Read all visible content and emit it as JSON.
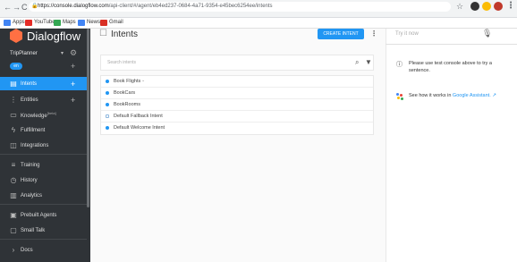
{
  "browser": {
    "back": "←",
    "forward": "→",
    "reload": "C",
    "url_domain": "https://console.dialogflow.com",
    "url_path": "/api-client/#/agent/eb4ed237-0684-4a71-9354-e45bec6254ee/intents",
    "bookmarks": [
      {
        "label": "Apps",
        "color": "#4285f4"
      },
      {
        "label": "YouTube",
        "color": "#e52d27"
      },
      {
        "label": "Maps",
        "color": "#34a853"
      },
      {
        "label": "News",
        "color": "#4285f4"
      },
      {
        "label": "Gmail",
        "color": "#d93025"
      }
    ]
  },
  "sidebar": {
    "brand": "Dialogflow",
    "agent_name": "TripPlanner",
    "language": "en",
    "items": [
      {
        "label": "Intents",
        "icon": "chat-icon",
        "active": true,
        "plus": true
      },
      {
        "label": "Entities",
        "icon": "entities-icon",
        "active": false,
        "plus": true
      },
      {
        "label": "Knowledge",
        "beta": "[beta]",
        "icon": "knowledge-icon",
        "active": false,
        "plus": false
      },
      {
        "label": "Fulfillment",
        "icon": "bolt-icon",
        "active": false,
        "plus": false
      },
      {
        "label": "Integrations",
        "icon": "integrations-icon",
        "active": false,
        "plus": false
      },
      {
        "label": "Training",
        "icon": "training-icon",
        "active": false,
        "plus": false
      },
      {
        "label": "History",
        "icon": "history-icon",
        "active": false,
        "plus": false
      },
      {
        "label": "Analytics",
        "icon": "analytics-icon",
        "active": false,
        "plus": false
      },
      {
        "label": "Prebuilt Agents",
        "icon": "prebuilt-icon",
        "active": false,
        "plus": false
      },
      {
        "label": "Small Talk",
        "icon": "smalltalk-icon",
        "active": false,
        "plus": false
      },
      {
        "label": "Docs",
        "icon": "chevron-right-icon",
        "active": false,
        "plus": false
      }
    ]
  },
  "main": {
    "title": "Intents",
    "create_button": "CREATE INTENT",
    "search_placeholder": "Search intents",
    "intents": [
      {
        "label": "Book Flights",
        "expandable": true,
        "type": "dot"
      },
      {
        "label": "BookCars",
        "expandable": false,
        "type": "dot"
      },
      {
        "label": "BookRooms",
        "expandable": false,
        "type": "dot"
      },
      {
        "label": "Default Fallback Intent",
        "expandable": false,
        "type": "hollow"
      },
      {
        "label": "Default Welcome Intent",
        "expandable": false,
        "type": "dot"
      }
    ]
  },
  "console": {
    "try_placeholder": "Try it now",
    "hint": "Please use test console above to try a sentence.",
    "how_prefix": "See how it works in",
    "how_link": "Google Assistant."
  }
}
